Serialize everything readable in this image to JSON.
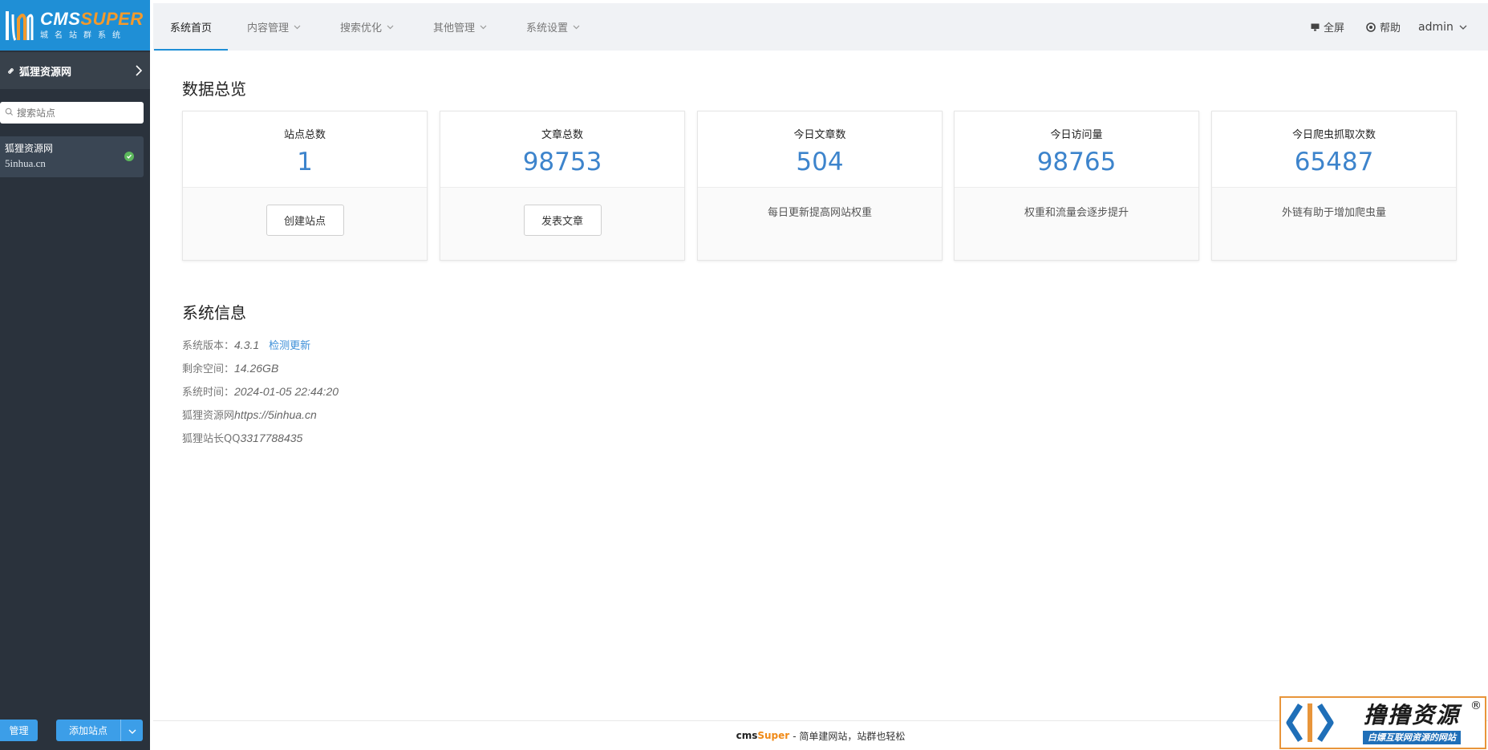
{
  "logo": {
    "title_a": "CMS",
    "title_b": "SUPER",
    "subtitle": "城名站群系统"
  },
  "sidebar": {
    "site_header": "狐狸资源网",
    "search_placeholder": "搜索站点",
    "sites": [
      {
        "name": "狐狸资源网",
        "domain": "5inhua.cn",
        "status": "online"
      }
    ],
    "manage_label": "管理",
    "add_site_label": "添加站点"
  },
  "nav": {
    "items": [
      {
        "label": "系统首页",
        "active": true,
        "has_caret": false
      },
      {
        "label": "内容管理",
        "active": false,
        "has_caret": true
      },
      {
        "label": "搜索优化",
        "active": false,
        "has_caret": true
      },
      {
        "label": "其他管理",
        "active": false,
        "has_caret": true
      },
      {
        "label": "系统设置",
        "active": false,
        "has_caret": true
      }
    ],
    "fullscreen_label": "全屏",
    "help_label": "帮助",
    "user_label": "admin"
  },
  "overview": {
    "title": "数据总览",
    "cards": [
      {
        "label": "站点总数",
        "value": "1",
        "button": "创建站点"
      },
      {
        "label": "文章总数",
        "value": "98753",
        "button": "发表文章"
      },
      {
        "label": "今日文章数",
        "value": "504",
        "desc": "每日更新提高网站权重"
      },
      {
        "label": "今日访问量",
        "value": "98765",
        "desc": "权重和流量会逐步提升"
      },
      {
        "label": "今日爬虫抓取次数",
        "value": "65487",
        "desc": "外链有助于增加爬虫量"
      }
    ]
  },
  "system_info": {
    "title": "系统信息",
    "rows": [
      {
        "label": "系统版本：",
        "value": "4.3.1",
        "action": "检测更新"
      },
      {
        "label": "剩余空间：",
        "value": "14.26GB"
      },
      {
        "label": "系统时间：",
        "value": "2024-01-05 22:44:20"
      },
      {
        "label": "狐狸资源网",
        "value": "https://5inhua.cn"
      },
      {
        "label": "狐狸站长QQ",
        "value": "3317788435"
      }
    ]
  },
  "footer": {
    "brand_a": "cms",
    "brand_b": "Super",
    "text": "- 简单建网站，站群也轻松"
  },
  "watermark": {
    "title": "撸撸资源",
    "registered": "®",
    "subtitle": "白嫖互联网资源的网站"
  },
  "colors": {
    "sidebar_bg": "#2a323c",
    "logo_bg": "#1f8fd6",
    "accent_blue": "#3c9ee8",
    "value_blue": "#3d84cc",
    "brand_orange": "#f08a18",
    "status_green": "#5cb85c"
  }
}
